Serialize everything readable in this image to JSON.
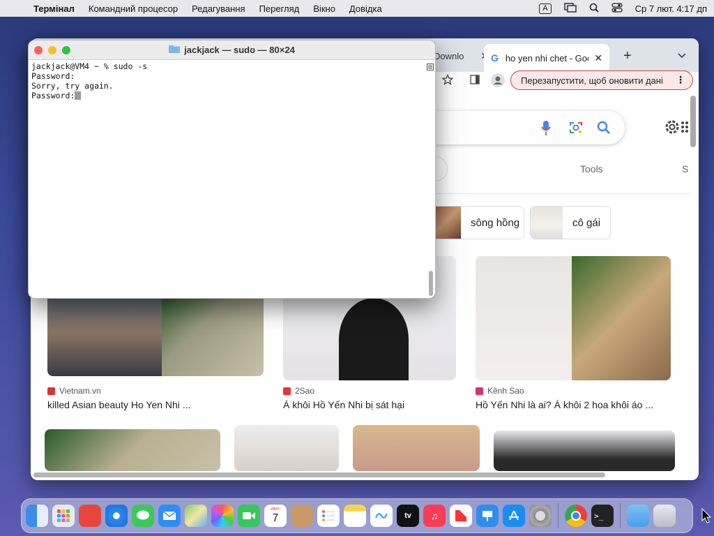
{
  "menubar": {
    "app": "Термінал",
    "items": [
      "Командний процесор",
      "Редагування",
      "Перегляд",
      "Вікно",
      "Довідка"
    ],
    "input_badge": "A",
    "clock": "Ср 7 лют. 4:17 дп"
  },
  "chrome": {
    "tab_inactive": "Downlo",
    "tab_active": "ho yen nhi chet - Goo",
    "new_tab": "+",
    "relaunch": "Перезапустити, щоб оновити дані",
    "tools": "Tools",
    "s_label": "S",
    "chips": [
      "sông hồng",
      "cô gái"
    ],
    "results": [
      {
        "source": "Vietnam.vn",
        "title": "killed Asian beauty Ho Yen Nhi ..."
      },
      {
        "source": "2Sao",
        "title": "Á khôi Hồ Yến Nhi bị sát hại"
      },
      {
        "source": "Kênh Sao",
        "title": "Hồ Yến Nhi là ai? Á khôi 2 hoa khôi áo ..."
      }
    ]
  },
  "terminal": {
    "title": "jackjack — sudo — 80×24",
    "lines": [
      "jackjack@VM4 ~ % sudo -s",
      "Password:",
      "Sorry, try again.",
      "Password:"
    ]
  },
  "colors": {
    "terminal_red": "#fe5f57",
    "terminal_yellow": "#febc2e",
    "terminal_green": "#28c840",
    "relaunch_border": "#cc4444"
  },
  "dock": {
    "apps": [
      "finder-icon",
      "launchpad-icon",
      "tv-icon",
      "safari-icon",
      "messages-icon",
      "mail-icon",
      "maps-icon",
      "photos-icon",
      "facetime-icon",
      "calendar-icon",
      "contacts-icon",
      "reminders-icon",
      "notes-icon",
      "freeform-icon",
      "appletv-icon",
      "music-icon",
      "news-icon",
      "keynote-icon",
      "appstore-icon",
      "settings-icon",
      "chrome-icon",
      "terminal-icon",
      "folder-icon",
      "trash-icon"
    ],
    "calendar_month": "лют.",
    "calendar_day": "7"
  }
}
